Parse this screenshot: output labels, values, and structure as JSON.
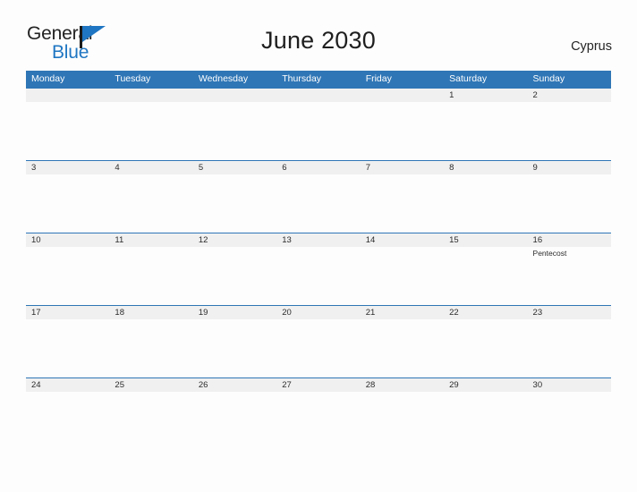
{
  "brand": {
    "name_part1": "General",
    "name_part2": "Blue",
    "flag_color": "#1f76c2"
  },
  "header": {
    "title": "June 2030",
    "country": "Cyprus"
  },
  "theme": {
    "header_blue": "#2f76b6",
    "date_band": "#f0f0f0",
    "page_background": "#fdfdfd",
    "text": "#2b2b2b"
  },
  "calendar": {
    "weekdays": [
      "Monday",
      "Tuesday",
      "Wednesday",
      "Thursday",
      "Friday",
      "Saturday",
      "Sunday"
    ],
    "weeks": [
      [
        {
          "date": "",
          "events": []
        },
        {
          "date": "",
          "events": []
        },
        {
          "date": "",
          "events": []
        },
        {
          "date": "",
          "events": []
        },
        {
          "date": "",
          "events": []
        },
        {
          "date": "1",
          "events": []
        },
        {
          "date": "2",
          "events": []
        }
      ],
      [
        {
          "date": "3",
          "events": []
        },
        {
          "date": "4",
          "events": []
        },
        {
          "date": "5",
          "events": []
        },
        {
          "date": "6",
          "events": []
        },
        {
          "date": "7",
          "events": []
        },
        {
          "date": "8",
          "events": []
        },
        {
          "date": "9",
          "events": []
        }
      ],
      [
        {
          "date": "10",
          "events": []
        },
        {
          "date": "11",
          "events": []
        },
        {
          "date": "12",
          "events": []
        },
        {
          "date": "13",
          "events": []
        },
        {
          "date": "14",
          "events": []
        },
        {
          "date": "15",
          "events": []
        },
        {
          "date": "16",
          "events": [
            "Pentecost"
          ]
        }
      ],
      [
        {
          "date": "17",
          "events": []
        },
        {
          "date": "18",
          "events": []
        },
        {
          "date": "19",
          "events": []
        },
        {
          "date": "20",
          "events": []
        },
        {
          "date": "21",
          "events": []
        },
        {
          "date": "22",
          "events": []
        },
        {
          "date": "23",
          "events": []
        }
      ],
      [
        {
          "date": "24",
          "events": []
        },
        {
          "date": "25",
          "events": []
        },
        {
          "date": "26",
          "events": []
        },
        {
          "date": "27",
          "events": []
        },
        {
          "date": "28",
          "events": []
        },
        {
          "date": "29",
          "events": []
        },
        {
          "date": "30",
          "events": []
        }
      ]
    ]
  }
}
